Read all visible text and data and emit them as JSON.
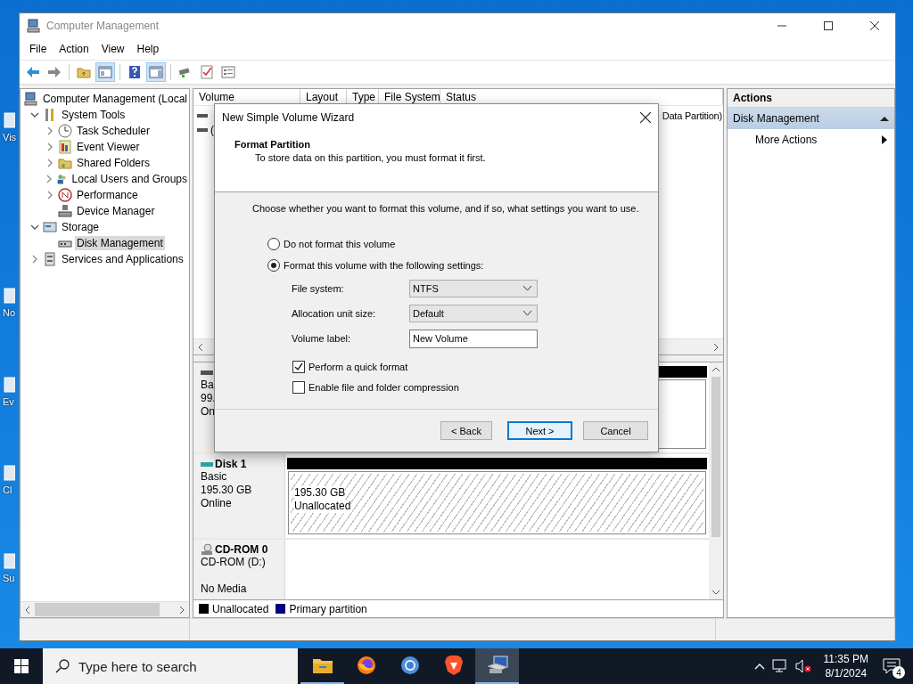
{
  "desktop_icons": [
    {
      "label": "Vis"
    },
    {
      "label": "No"
    },
    {
      "label": "Ev"
    },
    {
      "label": "Cl"
    },
    {
      "label": "Su"
    }
  ],
  "window": {
    "title": "Computer Management"
  },
  "menu": [
    "File",
    "Action",
    "View",
    "Help"
  ],
  "toolbar": [
    {
      "kind": "back",
      "pressed": false
    },
    {
      "kind": "forward",
      "pressed": false
    },
    {
      "kind": "up",
      "pressed": false
    },
    {
      "kind": "tree",
      "pressed": true
    },
    {
      "kind": "help",
      "pressed": false
    },
    {
      "kind": "pane",
      "pressed": true
    },
    {
      "kind": "connect",
      "pressed": false
    },
    {
      "kind": "check",
      "pressed": false
    },
    {
      "kind": "properties",
      "pressed": false
    }
  ],
  "tree": [
    {
      "label": "Computer Management (Local",
      "kind": "computer",
      "selected": false,
      "children": [
        {
          "label": "System Tools",
          "kind": "tools",
          "selected": false,
          "expanded": true,
          "children": [
            {
              "label": "Task Scheduler",
              "kind": "clock",
              "selected": false,
              "expanded": false
            },
            {
              "label": "Event Viewer",
              "kind": "viewer",
              "selected": false,
              "expanded": false
            },
            {
              "label": "Shared Folders",
              "kind": "folder",
              "selected": false,
              "expanded": false
            },
            {
              "label": "Local Users and Groups",
              "kind": "users",
              "selected": false,
              "expanded": false
            },
            {
              "label": "Performance",
              "kind": "performance",
              "selected": false,
              "expanded": false
            },
            {
              "label": "Device Manager",
              "kind": "device",
              "selected": false
            }
          ]
        },
        {
          "label": "Storage",
          "kind": "storage",
          "selected": false,
          "expanded": true,
          "children": [
            {
              "label": "Disk Management",
              "kind": "disk",
              "selected": true
            }
          ]
        },
        {
          "label": "Services and Applications",
          "kind": "services",
          "selected": false,
          "expanded": false
        }
      ]
    }
  ],
  "table": {
    "columns": [
      "Volume",
      "Layout",
      "Type",
      "File System",
      "Status"
    ],
    "rows": [
      {
        "status": "Data Partition)"
      },
      {
        "volume": "("
      }
    ]
  },
  "disks": [
    {
      "kind": "disk",
      "lines": [
        "Ba",
        "99.",
        "On"
      ],
      "partitions": [
        {
          "kind": "volume"
        }
      ]
    },
    {
      "kind": "disk",
      "name": "Disk 1",
      "lines": [
        "Basic",
        "195.30 GB",
        "Online"
      ],
      "partitions": [
        {
          "kind": "unallocated",
          "size": "195.30 GB",
          "label": "Unallocated"
        }
      ]
    },
    {
      "kind": "cdrom",
      "name": "CD-ROM 0",
      "lines": [
        "CD-ROM (D:)",
        "No Media"
      ]
    }
  ],
  "legend": [
    {
      "label": "Unallocated",
      "color": "#000000"
    },
    {
      "label": "Primary partition",
      "color": "#000080"
    }
  ],
  "actions": {
    "title": "Actions",
    "sections": [
      {
        "label": "Disk Management",
        "expanded": true,
        "items": [
          "More Actions"
        ]
      }
    ]
  },
  "dialog": {
    "title": "New Simple Volume Wizard",
    "heading": "Format Partition",
    "subtitle": "To store data on this partition, you must format it first.",
    "instruction": "Choose whether you want to format this volume, and if so, what settings you want to use.",
    "options": [
      {
        "label": "Do not format this volume",
        "selected": false
      },
      {
        "label": "Format this volume with the following settings:",
        "selected": true
      }
    ],
    "fields": [
      {
        "label": "File system:",
        "kind": "select",
        "value": "NTFS"
      },
      {
        "label": "Allocation unit size:",
        "kind": "select",
        "value": "Default"
      },
      {
        "label": "Volume label:",
        "kind": "text",
        "value": "New Volume"
      }
    ],
    "checkboxes": [
      {
        "label": "Perform a quick format",
        "checked": true
      },
      {
        "label": "Enable file and folder compression",
        "checked": false
      }
    ],
    "buttons": [
      {
        "label": "< Back",
        "default": false
      },
      {
        "label": "Next >",
        "default": true
      },
      {
        "label": "Cancel",
        "default": false
      }
    ]
  },
  "taskbar": {
    "search": {
      "placeholder": "Type here to search"
    },
    "apps": [
      {
        "kind": "explorer",
        "active": false,
        "running": true
      },
      {
        "kind": "firefox",
        "active": false,
        "running": false
      },
      {
        "kind": "chrome",
        "active": false,
        "running": false
      },
      {
        "kind": "brave",
        "active": false,
        "running": false
      },
      {
        "kind": "mmc",
        "active": true,
        "running": true
      }
    ],
    "clock": {
      "time": "11:35 PM",
      "date": "8/1/2024"
    },
    "notifications": "4"
  }
}
